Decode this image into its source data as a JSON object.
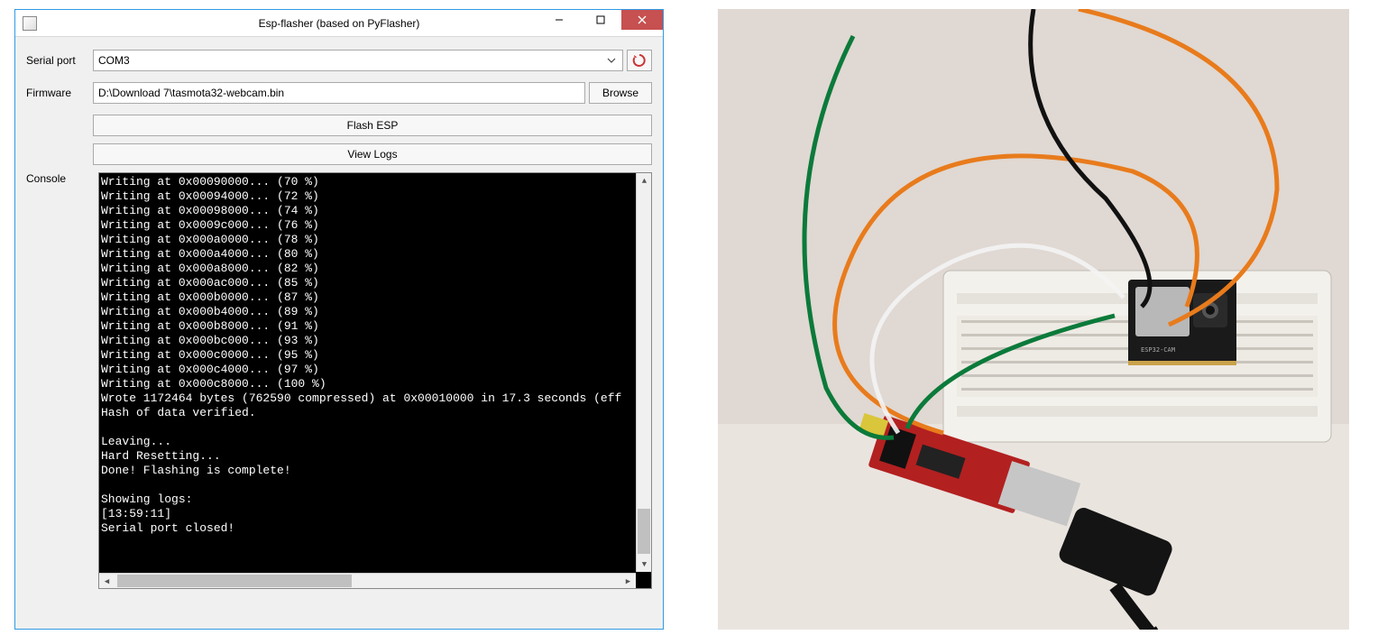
{
  "window": {
    "title": "Esp-flasher (based on PyFlasher)"
  },
  "rows": {
    "serial_port_label": "Serial port",
    "serial_port_value": "COM3",
    "firmware_label": "Firmware",
    "firmware_value": "D:\\Download 7\\tasmota32-webcam.bin",
    "browse_label": "Browse",
    "flash_label": "Flash ESP",
    "view_logs_label": "View Logs",
    "console_label": "Console"
  },
  "console_lines": [
    "Writing at 0x00090000... (70 %)",
    "Writing at 0x00094000... (72 %)",
    "Writing at 0x00098000... (74 %)",
    "Writing at 0x0009c000... (76 %)",
    "Writing at 0x000a0000... (78 %)",
    "Writing at 0x000a4000... (80 %)",
    "Writing at 0x000a8000... (82 %)",
    "Writing at 0x000ac000... (85 %)",
    "Writing at 0x000b0000... (87 %)",
    "Writing at 0x000b4000... (89 %)",
    "Writing at 0x000b8000... (91 %)",
    "Writing at 0x000bc000... (93 %)",
    "Writing at 0x000c0000... (95 %)",
    "Writing at 0x000c4000... (97 %)",
    "Writing at 0x000c8000... (100 %)",
    "Wrote 1172464 bytes (762590 compressed) at 0x00010000 in 17.3 seconds (eff",
    "Hash of data verified.",
    "",
    "Leaving...",
    "Hard Resetting...",
    "Done! Flashing is complete!",
    "",
    "Showing logs:",
    "[13:59:11]",
    "Serial port closed!"
  ],
  "icons": {
    "reload": "reload-icon"
  },
  "photo": {
    "description": "ESP32-CAM module on breadboard connected via jumper wires (green, orange, black, white) to a red USB-to-serial FTDI adapter with a black USB cable"
  }
}
